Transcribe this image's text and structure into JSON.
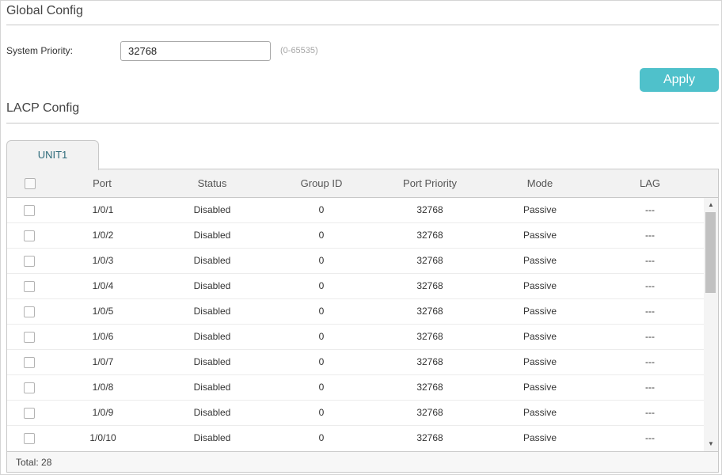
{
  "global": {
    "title": "Global Config",
    "priority_label": "System Priority:",
    "priority_value": "32768",
    "range_hint": "(0-65535)",
    "apply_label": "Apply"
  },
  "lacp": {
    "title": "LACP Config",
    "tab_label": "UNIT1",
    "headers": {
      "port": "Port",
      "status": "Status",
      "group_id": "Group ID",
      "port_priority": "Port Priority",
      "mode": "Mode",
      "lag": "LAG"
    },
    "rows": [
      {
        "port": "1/0/1",
        "status": "Disabled",
        "group_id": "0",
        "port_priority": "32768",
        "mode": "Passive",
        "lag": "---"
      },
      {
        "port": "1/0/2",
        "status": "Disabled",
        "group_id": "0",
        "port_priority": "32768",
        "mode": "Passive",
        "lag": "---"
      },
      {
        "port": "1/0/3",
        "status": "Disabled",
        "group_id": "0",
        "port_priority": "32768",
        "mode": "Passive",
        "lag": "---"
      },
      {
        "port": "1/0/4",
        "status": "Disabled",
        "group_id": "0",
        "port_priority": "32768",
        "mode": "Passive",
        "lag": "---"
      },
      {
        "port": "1/0/5",
        "status": "Disabled",
        "group_id": "0",
        "port_priority": "32768",
        "mode": "Passive",
        "lag": "---"
      },
      {
        "port": "1/0/6",
        "status": "Disabled",
        "group_id": "0",
        "port_priority": "32768",
        "mode": "Passive",
        "lag": "---"
      },
      {
        "port": "1/0/7",
        "status": "Disabled",
        "group_id": "0",
        "port_priority": "32768",
        "mode": "Passive",
        "lag": "---"
      },
      {
        "port": "1/0/8",
        "status": "Disabled",
        "group_id": "0",
        "port_priority": "32768",
        "mode": "Passive",
        "lag": "---"
      },
      {
        "port": "1/0/9",
        "status": "Disabled",
        "group_id": "0",
        "port_priority": "32768",
        "mode": "Passive",
        "lag": "---"
      },
      {
        "port": "1/0/10",
        "status": "Disabled",
        "group_id": "0",
        "port_priority": "32768",
        "mode": "Passive",
        "lag": "---"
      }
    ],
    "total": "Total: 28"
  },
  "colors": {
    "accent": "#4fc1cb",
    "tab_text": "#2d6a7a",
    "header_bg": "#f2f2f2"
  },
  "icons": {
    "scroll_up": "caret-up-icon",
    "scroll_down": "caret-down-icon"
  }
}
